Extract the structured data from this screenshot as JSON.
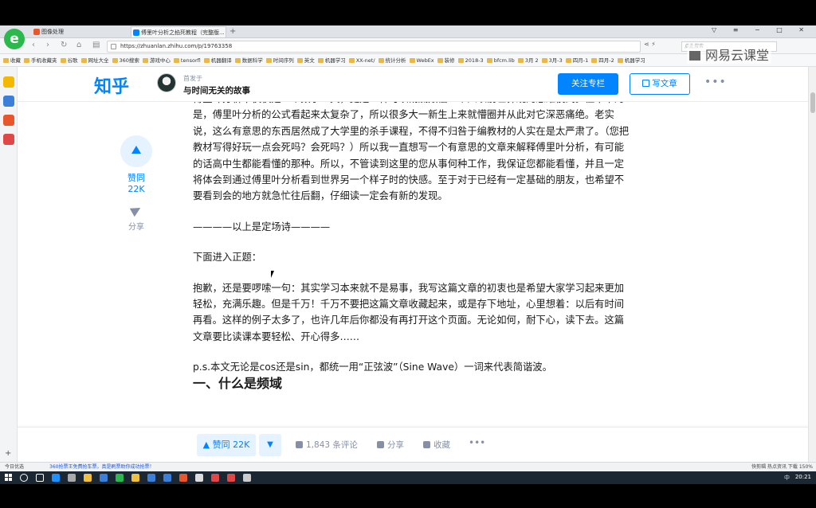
{
  "browser": {
    "tabs": [
      {
        "label": "图像处理",
        "color": "#e8562b"
      },
      {
        "label": "傅里叶分析之掐死教程（完整版...",
        "color": "#0084ff"
      }
    ],
    "new_tab": "+",
    "url": "https://zhuanlan.zhihu.com/p/19763358",
    "search_placeholder": "点此搜索",
    "bookmarks": [
      "收藏",
      "手机收藏夹",
      "谷歌",
      "网址大全",
      "360搜索",
      "游戏中心",
      "tensorfl",
      "机器翻译",
      "数据科学",
      "时间序列",
      "英文",
      "机器学习",
      "XX-net/",
      "统计分析",
      "WebEx",
      "装修",
      "2018-3",
      "bfcm.lib",
      "3月 2",
      "3月-3",
      "四月-1",
      "四月-2",
      "机器学习"
    ]
  },
  "zhihu": {
    "logo": "知乎",
    "published_in": "首发于",
    "column_title": "与时间无关的故事",
    "follow_button": "关注专栏",
    "write_button": "写文章",
    "more": "•••",
    "vote_count": "赞同 22K",
    "share": "分享"
  },
  "article": {
    "paragraphs": [
      "傅里叶分析不仅仅是一个数学工具，更是一种可以彻底颠覆一个人以前世界观的思维模式。但不幸的是，傅里叶分析的公式看起来太复杂了，所以很多大一新生上来就懵圈并从此对它深恶痛绝。老实说，这么有意思的东西居然成了大学里的杀手课程，不得不归咎于编教材的人实在是太严肃了。（您把教材写得好玩一点会死吗？会死吗？）所以我一直想写一个有意思的文章来解释傅里叶分析，有可能的话高中生都能看懂的那种。所以，不管读到这里的您从事何种工作，我保证您都能看懂，并且一定将体会到通过傅里叶分析看到世界另一个样子时的快感。至于对于已经有一定基础的朋友，也希望不要看到会的地方就急忙往后翻，仔细读一定会有新的发现。",
      "————以上是定场诗————",
      "下面进入正题：",
      "抱歉，还是要啰嗦一句：其实学习本来就不是易事，我写这篇文章的初衷也是希望大家学习起来更加轻松，充满乐趣。但是千万！千万不要把这篇文章收藏起来，或是存下地址，心里想着：以后有时间再看。这样的例子太多了，也许几年后你都没有再打开这个页面。无论如何，耐下心，读下去。这篇文章要比读课本要轻松、开心得多……",
      "p.s.本文无论是cos还是sin，都统一用“正弦波”（Sine Wave）一词来代表简谐波。"
    ],
    "section_heading": "一、什么是频域"
  },
  "bottom_bar": {
    "vote": "▲ 赞同 22K",
    "down": "▼",
    "comments": "1,843 条评论",
    "share": "分享",
    "collect": "收藏",
    "more": "•••"
  },
  "watermark": "网易云课堂",
  "statusbar": {
    "left": "今日优选",
    "news": "360抢票王免费抢车票，真是刷票助你成功抢票！",
    "right": "快剪辑    热点资讯    下载    150%"
  },
  "taskbar": {
    "clock": "20:21",
    "tray": "中"
  }
}
